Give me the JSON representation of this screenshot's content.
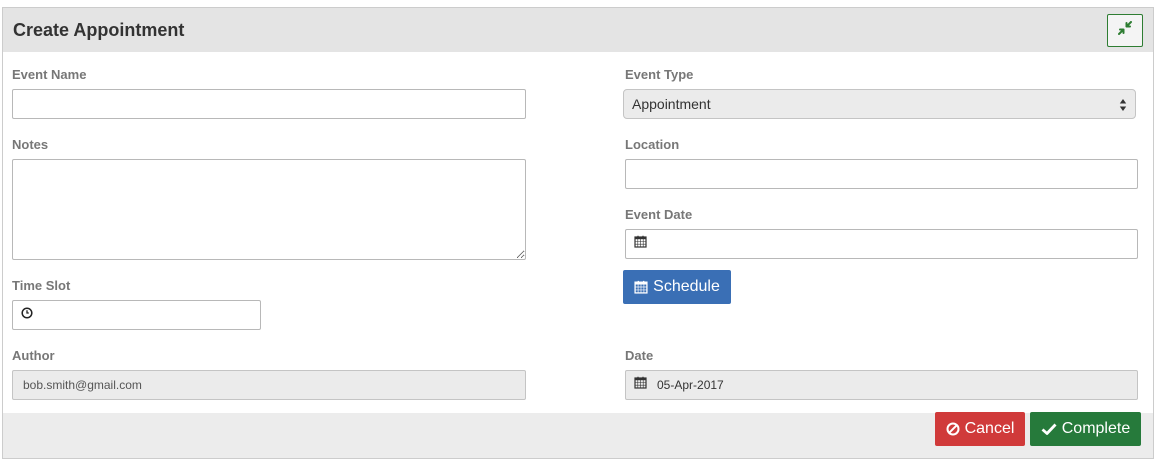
{
  "header": {
    "title": "Create Appointment",
    "collapse_icon": "compress-icon"
  },
  "form": {
    "event_name": {
      "label": "Event Name",
      "value": "",
      "placeholder": ""
    },
    "notes": {
      "label": "Notes",
      "value": "",
      "placeholder": ""
    },
    "time_slot": {
      "label": "Time Slot",
      "value": "",
      "icon": "clock-icon"
    },
    "author": {
      "label": "Author",
      "value": "bob.smith@gmail.com"
    },
    "event_type": {
      "label": "Event Type",
      "selected": "Appointment"
    },
    "location": {
      "label": "Location",
      "value": ""
    },
    "event_date": {
      "label": "Event Date",
      "value": "",
      "icon": "calendar-icon"
    },
    "schedule_button": {
      "label": "Schedule",
      "icon": "calendar-icon"
    },
    "date": {
      "label": "Date",
      "value": "05-Apr-2017",
      "icon": "calendar-icon"
    }
  },
  "footer": {
    "cancel_label": "Cancel",
    "complete_label": "Complete"
  },
  "colors": {
    "cancel": "#d03a3a",
    "complete": "#267a3b",
    "schedule": "#3a6fb5",
    "header_bg": "#e4e4e4"
  }
}
